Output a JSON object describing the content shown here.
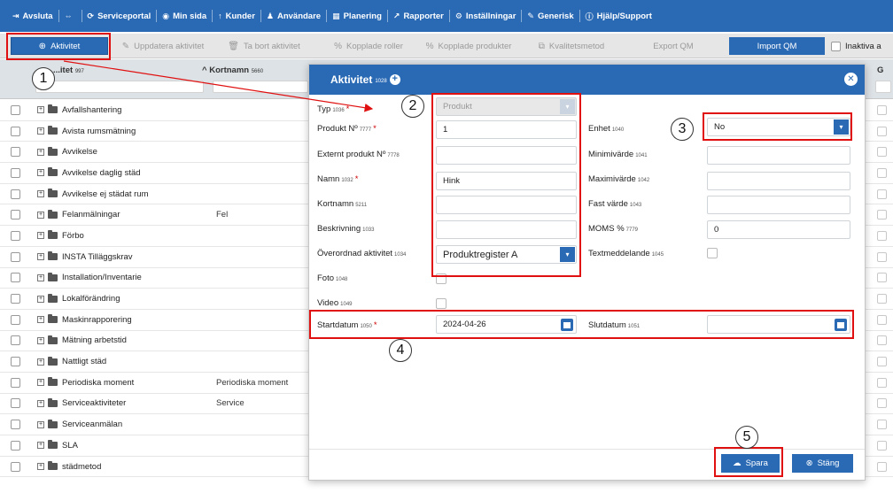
{
  "topnav": {
    "items": [
      {
        "label": "Avsluta",
        "icon": "⇥"
      },
      {
        "label": "",
        "icon": "⇔"
      },
      {
        "label": "Serviceportal",
        "icon": "⟳"
      },
      {
        "label": "Min sida",
        "icon": "◉"
      },
      {
        "label": "Kunder",
        "icon": "↑"
      },
      {
        "label": "Användare",
        "icon": "♟"
      },
      {
        "label": "Planering",
        "icon": "▦"
      },
      {
        "label": "Rapporter",
        "icon": "↗"
      },
      {
        "label": "Inställningar",
        "icon": "⚙"
      },
      {
        "label": "Generisk",
        "icon": "✎"
      },
      {
        "label": "Hjälp/Support",
        "icon": "ⓘ"
      }
    ]
  },
  "toolbar": {
    "add_activity": "Aktivitet",
    "update_activity": "Uppdatera aktivitet",
    "delete_activity": "Ta bort aktivitet",
    "linked_roles": "Kopplade roller",
    "linked_products": "Kopplade produkter",
    "quality_method": "Kvalitetsmetod",
    "export_qm": "Export QM",
    "import_qm": "Import QM",
    "inactive_label": "Inaktiva a"
  },
  "grid": {
    "col_activity": "...itet",
    "col_activity_ref": "997",
    "col_shortname": "Kortnamn",
    "col_shortname_ref": "5660",
    "col_right": "G",
    "rows": [
      {
        "name": "Avfallshantering",
        "short": ""
      },
      {
        "name": "Avista rumsmätning",
        "short": ""
      },
      {
        "name": "Avvikelse",
        "short": ""
      },
      {
        "name": "Avvikelse daglig städ",
        "short": ""
      },
      {
        "name": "Avvikelse ej städat rum",
        "short": ""
      },
      {
        "name": "Felanmälningar",
        "short": "Fel"
      },
      {
        "name": "Förbo",
        "short": ""
      },
      {
        "name": "INSTA Tilläggskrav",
        "short": ""
      },
      {
        "name": "Installation/Inventarie",
        "short": ""
      },
      {
        "name": "Lokalförändring",
        "short": ""
      },
      {
        "name": "Maskinrapporering",
        "short": ""
      },
      {
        "name": "Mätning arbetstid",
        "short": ""
      },
      {
        "name": "Nattligt städ",
        "short": ""
      },
      {
        "name": "Periodiska moment",
        "short": "Periodiska moment"
      },
      {
        "name": "Serviceaktiviteter",
        "short": "Service"
      },
      {
        "name": "Serviceanmälan",
        "short": ""
      },
      {
        "name": "SLA",
        "short": ""
      },
      {
        "name": "städmetod",
        "short": ""
      }
    ]
  },
  "modal": {
    "title": "Aktivitet",
    "title_ref": "1028",
    "fields": {
      "typ": {
        "label": "Typ",
        "ref": "1036",
        "value": "Produkt"
      },
      "produkt_nr": {
        "label": "Produkt Nº",
        "ref": "7777",
        "value": "1"
      },
      "externt_produkt_nr": {
        "label": "Externt produkt Nº",
        "ref": "7778",
        "value": ""
      },
      "namn": {
        "label": "Namn",
        "ref": "1032",
        "value": "Hink"
      },
      "kortnamn": {
        "label": "Kortnamn",
        "ref": "5211",
        "value": ""
      },
      "beskrivning": {
        "label": "Beskrivning",
        "ref": "1033",
        "value": ""
      },
      "overordnad": {
        "label": "Överordnad aktivitet",
        "ref": "1034",
        "value": "Produktregister A"
      },
      "foto": {
        "label": "Foto",
        "ref": "1048"
      },
      "video": {
        "label": "Video",
        "ref": "1049"
      },
      "startdatum": {
        "label": "Startdatum",
        "ref": "1050",
        "value": "2024-04-26"
      },
      "enhet": {
        "label": "Enhet",
        "ref": "1040",
        "value": "No"
      },
      "minimivarde": {
        "label": "Minimivärde",
        "ref": "1041",
        "value": ""
      },
      "maximivarde": {
        "label": "Maximivärde",
        "ref": "1042",
        "value": ""
      },
      "fast_varde": {
        "label": "Fast värde",
        "ref": "1043",
        "value": ""
      },
      "moms": {
        "label": "MOMS %",
        "ref": "7779",
        "value": "0"
      },
      "textmeddelande": {
        "label": "Textmeddelande",
        "ref": "1045"
      },
      "slutdatum": {
        "label": "Slutdatum",
        "ref": "1051",
        "value": ""
      }
    },
    "save": "Spara",
    "close": "Stäng"
  },
  "annotations": {
    "b1": "1",
    "b2": "2",
    "b3": "3",
    "b4": "4",
    "b5": "5",
    "color": "#e01010"
  },
  "colors": {
    "brand": "#2a6ab5",
    "annotation": "#e01010"
  }
}
